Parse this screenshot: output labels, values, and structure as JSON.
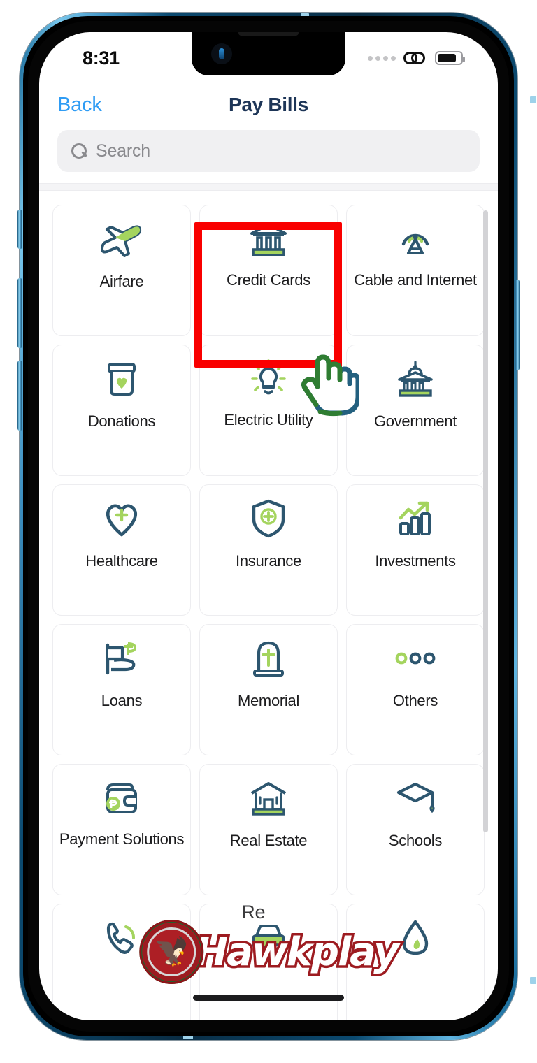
{
  "status_bar": {
    "time": "8:31",
    "signal_icon": "signal-dots-icon",
    "link_icon": "link-chain-icon",
    "battery_icon": "battery-icon"
  },
  "nav": {
    "back_label": "Back",
    "title": "Pay Bills"
  },
  "search": {
    "placeholder": "Search",
    "value": "",
    "icon": "search-icon"
  },
  "grid": {
    "tiles": [
      {
        "label": "Airfare",
        "icon": "airplane-icon",
        "highlighted": false
      },
      {
        "label": "Credit Cards",
        "icon": "bank-icon",
        "highlighted": true
      },
      {
        "label": "Cable and Internet",
        "icon": "antenna-icon",
        "highlighted": false
      },
      {
        "label": "Donations",
        "icon": "donation-box-icon",
        "highlighted": false
      },
      {
        "label": "Electric Utility",
        "icon": "lightbulb-icon",
        "highlighted": false
      },
      {
        "label": "Government",
        "icon": "capitol-icon",
        "highlighted": false
      },
      {
        "label": "Healthcare",
        "icon": "heart-plus-icon",
        "highlighted": false
      },
      {
        "label": "Insurance",
        "icon": "shield-plus-icon",
        "highlighted": false
      },
      {
        "label": "Investments",
        "icon": "bar-chart-up-icon",
        "highlighted": false
      },
      {
        "label": "Loans",
        "icon": "hand-peso-flag-icon",
        "highlighted": false
      },
      {
        "label": "Memorial",
        "icon": "tombstone-icon",
        "highlighted": false
      },
      {
        "label": "Others",
        "icon": "three-dots-icon",
        "highlighted": false
      },
      {
        "label": "Payment Solutions",
        "icon": "wallet-peso-icon",
        "highlighted": false
      },
      {
        "label": "Real Estate",
        "icon": "house-bank-icon",
        "highlighted": false
      },
      {
        "label": "Schools",
        "icon": "graduation-cap-icon",
        "highlighted": false
      },
      {
        "label": "",
        "icon": "phone-icon",
        "highlighted": false
      },
      {
        "label": "",
        "icon": "car-icon",
        "highlighted": false
      },
      {
        "label": "",
        "icon": "water-drop-icon",
        "highlighted": false
      }
    ]
  },
  "watermark": {
    "brand": "Hawkplay",
    "behind_text": "Re"
  },
  "colors": {
    "icon_dark": "#2d566f",
    "icon_green": "#a4d45e",
    "accent_blue": "#2f9cf4",
    "title_navy": "#1d3557",
    "highlight_red": "#f90000",
    "watermark_red": "#9d1b20"
  }
}
